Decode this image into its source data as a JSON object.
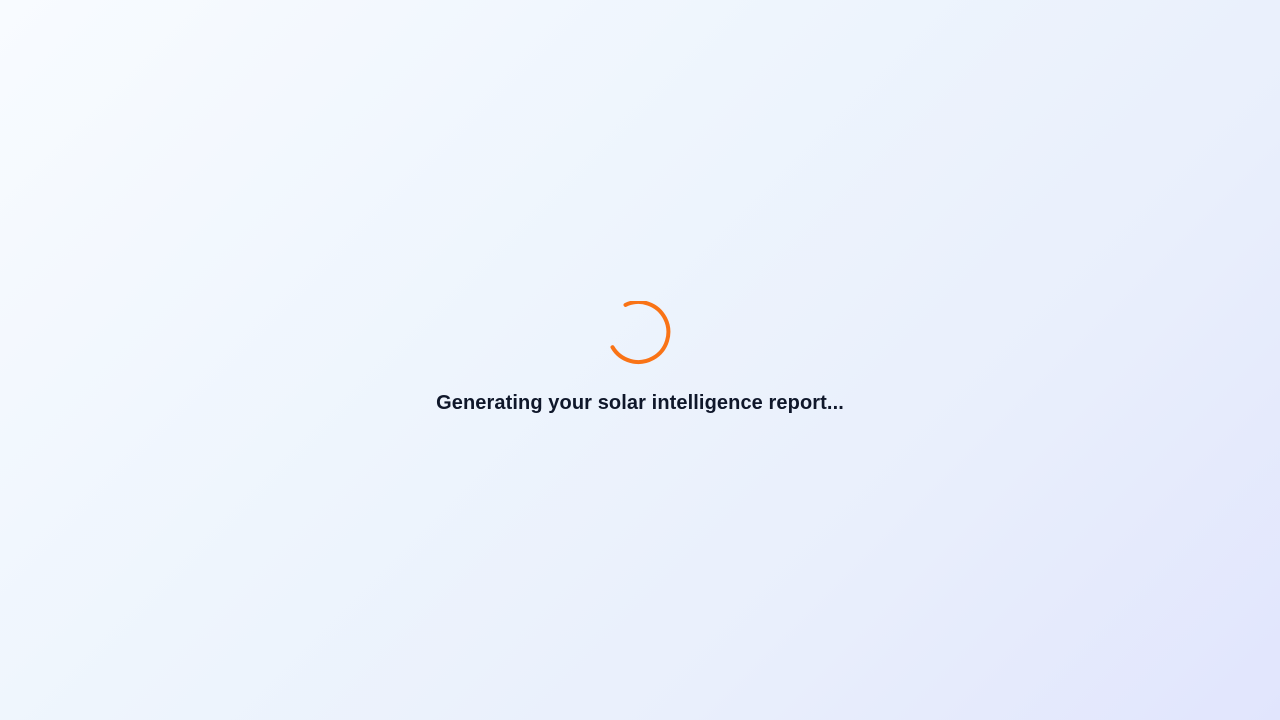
{
  "loading": {
    "message": "Generating your solar intelligence report...",
    "spinner_icon": "loading-spinner-icon",
    "spinner_color": "#f97316",
    "text_color": "#0f172a"
  },
  "background": {
    "gradient_start": "#f8fbff",
    "gradient_end": "#e1e5fd"
  }
}
